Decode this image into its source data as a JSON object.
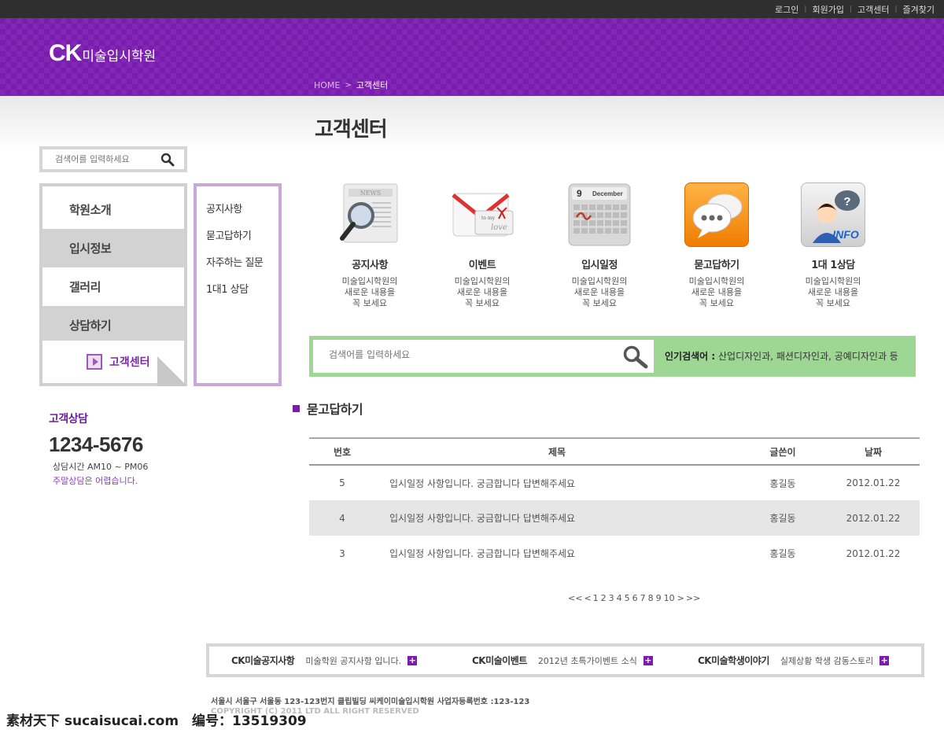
{
  "toplinks": [
    "로그인",
    "회원가입",
    "고객센터",
    "즐겨찾기"
  ],
  "logo": {
    "ck": "CK",
    "name": "미술입시학원"
  },
  "breadcrumb": {
    "home": "HOME",
    "current": "고객센터"
  },
  "page_title": "고객센터",
  "side_search": {
    "placeholder": "검색어를 입력하세요"
  },
  "leftnav": {
    "items": [
      "학원소개",
      "입시정보",
      "갤러리",
      "상담하기"
    ],
    "active": "고객센터"
  },
  "subnav": [
    "공지사항",
    "묻고답하기",
    "자주하는 질문",
    "1대1 상담"
  ],
  "contact": {
    "title": "고객상담",
    "tel": "1234-5676",
    "hours": "상담시간 AM10 ~ PM06",
    "weekend": "주말상담은 어렵습니다."
  },
  "icons": [
    {
      "title": "공지사항",
      "desc1": "미술입시학원의",
      "desc2": "새로운 내용을",
      "desc3": "꼭 보세요",
      "icon": "news-magnifier-icon"
    },
    {
      "title": "이벤트",
      "desc1": "미술입시학원의",
      "desc2": "새로운 내용을",
      "desc3": "꼭 보세요",
      "icon": "envelope-icon",
      "env_text1": "to my",
      "env_text2": "love"
    },
    {
      "title": "입시일정",
      "desc1": "미술입시학원의",
      "desc2": "새로운 내용을",
      "desc3": "꼭 보세요",
      "icon": "calendar-icon",
      "cal_day": "9",
      "cal_month": "December"
    },
    {
      "title": "묻고답하기",
      "desc1": "미술입시학원의",
      "desc2": "새로운 내용을",
      "desc3": "꼭 보세요",
      "icon": "chat-bubbles-icon"
    },
    {
      "title": "1대 1상담",
      "desc1": "미술입시학원의",
      "desc2": "새로운 내용을",
      "desc3": "꼭 보세요",
      "icon": "info-operator-icon",
      "info_text": "INFO"
    }
  ],
  "main_search": {
    "placeholder": "검색어를 입력하세요",
    "popular_label": "인기검색어 :",
    "popular_terms": "산업디자인과, 패션디자인과, 공예디자인과 등"
  },
  "section_title": "묻고답하기",
  "board": {
    "headers": {
      "no": "번호",
      "title": "제목",
      "writer": "글쓴이",
      "date": "날짜"
    },
    "rows": [
      {
        "no": "5",
        "title": "입시일정 사항입니다. 궁금합니다 답변해주세요",
        "writer": "홍길동",
        "date": "2012.01.22"
      },
      {
        "no": "4",
        "title": "입시일정 사항입니다. 궁금합니다 답변해주세요",
        "writer": "홍길동",
        "date": "2012.01.22"
      },
      {
        "no": "3",
        "title": "입시일정 사항입니다. 궁금합니다 답변해주세요",
        "writer": "홍길동",
        "date": "2012.01.22"
      }
    ]
  },
  "pagination": {
    "first": "<<",
    "prev": "<",
    "pages": [
      "1",
      "2",
      "3",
      "4",
      "5",
      "6",
      "7",
      "8",
      "9",
      "10"
    ],
    "next": ">",
    "last": ">>"
  },
  "footer_links": [
    {
      "title": "CK미술공지사항",
      "desc": "미술학원 공지사항 입니다."
    },
    {
      "title": "CK미술이벤트",
      "desc": "2012년 초특가이벤트 소식"
    },
    {
      "title": "CK미술학생이야기",
      "desc": "실제상황 학생 감동스토리"
    }
  ],
  "address": "서울시 서울구 서울동 123-123번지 클립빌딩 씨케이미술입시학원 사업자등록번호 :123-123",
  "copyright": "COPYRIGHT (C) 2011 LTD ALL RIGHT RESERVED",
  "watermark": {
    "left": "素材天下 sucaisucai.com",
    "right": "编号：13519309"
  },
  "colors": {
    "brand_purple": "#7a1cb0",
    "search_green": "#9ed694",
    "subnav_border": "#c9a6dc"
  }
}
